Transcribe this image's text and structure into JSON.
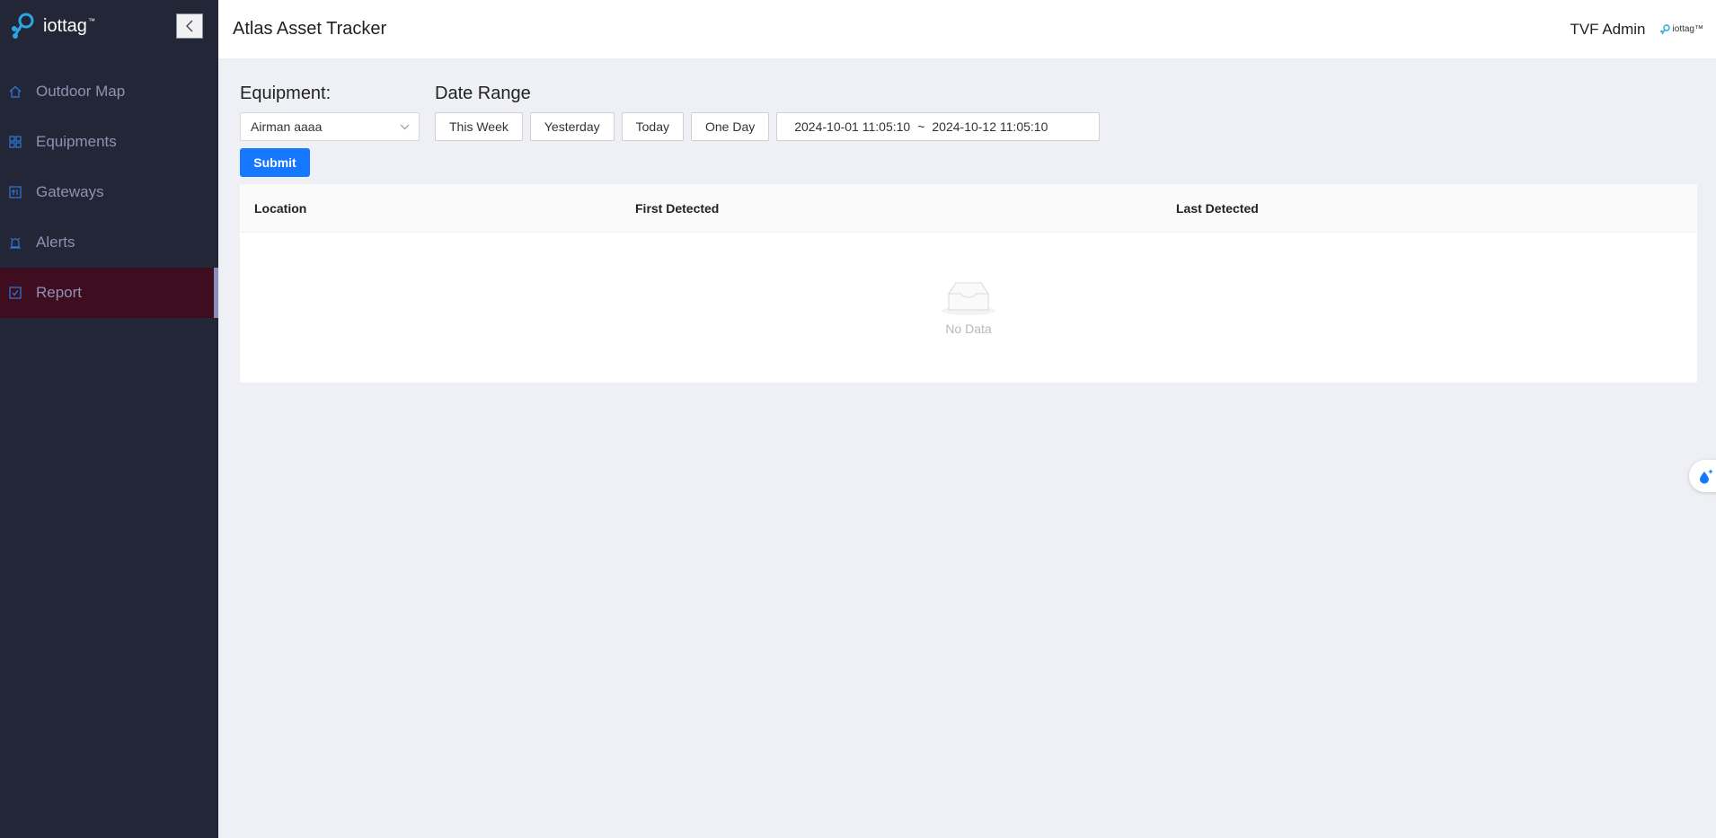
{
  "sidebar": {
    "brand": "iottag",
    "brand_tm": "™",
    "items": [
      {
        "label": "Outdoor Map",
        "icon": "home-icon"
      },
      {
        "label": "Equipments",
        "icon": "grid-icon"
      },
      {
        "label": "Gateways",
        "icon": "gateway-icon"
      },
      {
        "label": "Alerts",
        "icon": "alarm-icon"
      },
      {
        "label": "Report",
        "icon": "checkbox-icon",
        "active": true
      }
    ]
  },
  "header": {
    "title": "Atlas Asset Tracker",
    "user": "TVF Admin",
    "small_logo": "iottag™"
  },
  "filters": {
    "equipment_label": "Equipment:",
    "equipment_value": "Airman aaaa",
    "date_range_label": "Date Range",
    "presets": [
      "This Week",
      "Yesterday",
      "Today",
      "One Day"
    ],
    "range_start": "2024-10-01 11:05:10",
    "range_separator": "~",
    "range_end": "2024-10-12 11:05:10",
    "submit_label": "Submit"
  },
  "table": {
    "columns": [
      "Location",
      "First Detected",
      "Last Detected"
    ],
    "rows": [],
    "empty_text": "No Data"
  },
  "colors": {
    "sidebar_bg": "#232636",
    "active_bg": "#3e0d20",
    "primary": "#1677ff",
    "nav_icon": "#2f7bd8"
  }
}
